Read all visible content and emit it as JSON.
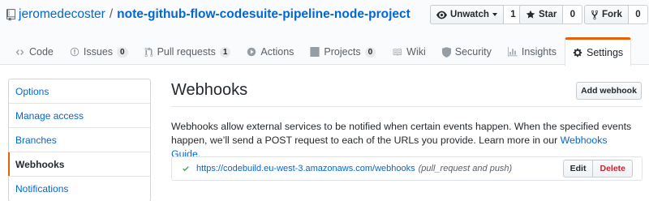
{
  "repo": {
    "owner": "jeromedecoster",
    "separator": "/",
    "name": "note-github-flow-codesuite-pipeline-node-project"
  },
  "actions": {
    "watch": {
      "label": "Unwatch",
      "count": "1"
    },
    "star": {
      "label": "Star",
      "count": "0"
    },
    "fork": {
      "label": "Fork",
      "count": "0"
    }
  },
  "tabs": [
    {
      "label": "Code",
      "icon": "code-icon"
    },
    {
      "label": "Issues",
      "icon": "issue-icon",
      "count": "0"
    },
    {
      "label": "Pull requests",
      "icon": "pull-request-icon",
      "count": "1"
    },
    {
      "label": "Actions",
      "icon": "play-icon"
    },
    {
      "label": "Projects",
      "icon": "project-icon",
      "count": "0"
    },
    {
      "label": "Wiki",
      "icon": "book-icon"
    },
    {
      "label": "Security",
      "icon": "shield-icon"
    },
    {
      "label": "Insights",
      "icon": "graph-icon"
    },
    {
      "label": "Settings",
      "icon": "gear-icon",
      "selected": true
    }
  ],
  "menu": [
    {
      "label": "Options"
    },
    {
      "label": "Manage access"
    },
    {
      "label": "Branches"
    },
    {
      "label": "Webhooks",
      "selected": true
    },
    {
      "label": "Notifications"
    }
  ],
  "main": {
    "title": "Webhooks",
    "add_button": "Add webhook",
    "description": "Webhooks allow external services to be notified when certain events happen. When the specified events happen, we’ll send a POST request to each of the URLs you provide. Learn more in our ",
    "guide_link": "Webhooks Guide",
    "description_end": "."
  },
  "webhooks": [
    {
      "url": "https://codebuild.eu-west-3.amazonaws.com/webhooks",
      "events": "(pull_request and push)",
      "edit": "Edit",
      "delete": "Delete",
      "status": "success"
    }
  ],
  "colors": {
    "link": "#0366d6",
    "accent": "#e36209",
    "success": "#28a745",
    "danger": "#cb2431"
  }
}
